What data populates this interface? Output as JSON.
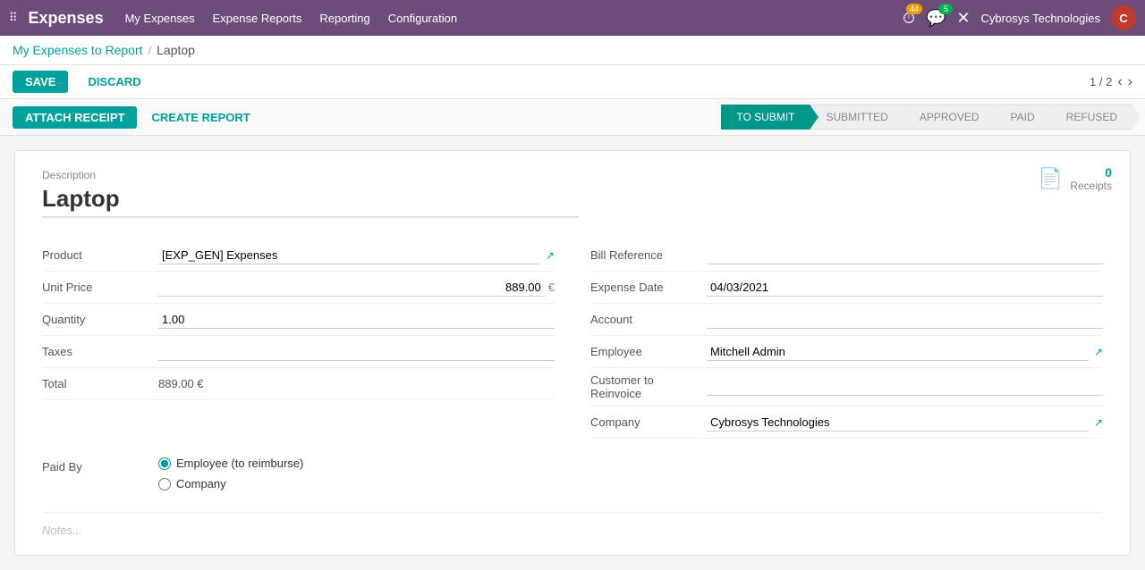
{
  "app": {
    "title": "Expenses"
  },
  "nav": {
    "links": [
      {
        "id": "my-expenses",
        "label": "My Expenses"
      },
      {
        "id": "expense-reports",
        "label": "Expense Reports"
      },
      {
        "id": "reporting",
        "label": "Reporting"
      },
      {
        "id": "configuration",
        "label": "Configuration"
      }
    ],
    "alerts_count": "44",
    "messages_count": "5",
    "company": "Cybrosys Technologies",
    "avatar_initials": "C"
  },
  "breadcrumb": {
    "parent": "My Expenses to Report",
    "separator": "/",
    "current": "Laptop"
  },
  "toolbar": {
    "save_label": "SAVE",
    "discard_label": "DISCARD",
    "pager": "1 / 2"
  },
  "action_bar": {
    "attach_label": "ATTACH RECEIPT",
    "create_label": "CREATE REPORT"
  },
  "status_pipeline": [
    {
      "id": "to-submit",
      "label": "TO SUBMIT",
      "active": true
    },
    {
      "id": "submitted",
      "label": "SUBMITTED",
      "active": false
    },
    {
      "id": "approved",
      "label": "APPROVED",
      "active": false
    },
    {
      "id": "paid",
      "label": "PAID",
      "active": false
    },
    {
      "id": "refused",
      "label": "REFUSED",
      "active": false
    }
  ],
  "receipts": {
    "count": "0",
    "label": "Receipts"
  },
  "form": {
    "description_label": "Description",
    "description_value": "Laptop",
    "left": {
      "product_label": "Product",
      "product_value": "[EXP_GEN] Expenses",
      "unit_price_label": "Unit Price",
      "unit_price_value": "889.00",
      "unit_price_currency": "€",
      "quantity_label": "Quantity",
      "quantity_value": "1.00",
      "taxes_label": "Taxes",
      "taxes_value": "",
      "total_label": "Total",
      "total_value": "889.00 €"
    },
    "right": {
      "bill_ref_label": "Bill Reference",
      "bill_ref_value": "",
      "expense_date_label": "Expense Date",
      "expense_date_value": "04/03/2021",
      "account_label": "Account",
      "account_value": "",
      "employee_label": "Employee",
      "employee_value": "Mitchell Admin",
      "customer_reinvoice_label": "Customer to Reinvoice",
      "customer_reinvoice_value": "",
      "company_label": "Company",
      "company_value": "Cybrosys Technologies"
    },
    "paid_by": {
      "label": "Paid By",
      "options": [
        {
          "id": "employee",
          "label": "Employee (to reimburse)",
          "selected": true
        },
        {
          "id": "company",
          "label": "Company",
          "selected": false
        }
      ]
    },
    "notes_placeholder": "Notes..."
  }
}
